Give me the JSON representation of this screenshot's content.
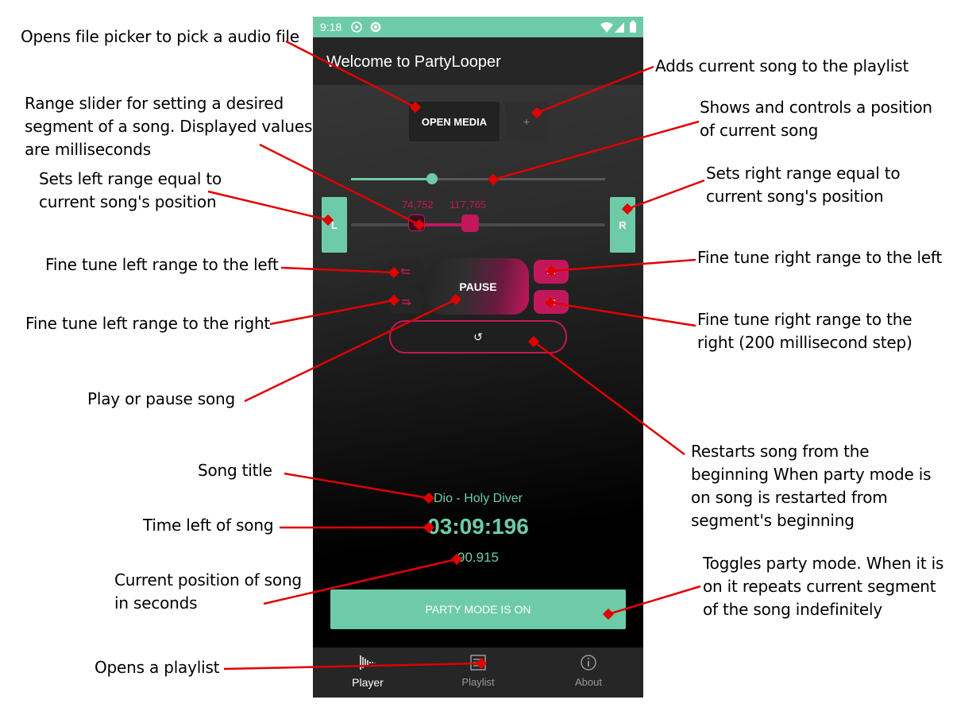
{
  "app": {
    "status_time": "9:18",
    "title": "Welcome to PartyLooper",
    "open_media_label": "OPEN MEDIA",
    "add_label": "+",
    "seek_progress": 0.32,
    "range": {
      "left_label": "74,752",
      "right_label": "117,765",
      "left_fraction": 0.26,
      "right_fraction": 0.47
    },
    "left_button_label": "L",
    "right_button_label": "R",
    "pause_label": "PAUSE",
    "restart_icon": "↺",
    "song_title": "Dio - Holy Diver",
    "time_left": "03:09:196",
    "position": "90.915",
    "party_label": "PARTY MODE IS ON",
    "nav": [
      {
        "label": "Player",
        "icon": "waveform-icon"
      },
      {
        "label": "Playlist",
        "icon": "playlist-icon"
      },
      {
        "label": "About",
        "icon": "info-icon"
      }
    ]
  },
  "annotations": {
    "open_media": "Opens file picker to pick a audio file",
    "add_song": "Adds current song to the playlist",
    "range_slider": "Range slider for setting a desired segment of a song. Displayed values are milliseconds",
    "seek": "Shows and controls a position of current song",
    "left_range": "Sets left range equal to current song's position",
    "right_range": "Sets right range equal to current song's position",
    "fine_left_left": "Fine tune left range to the left",
    "fine_right_left": "Fine tune right range to the left",
    "fine_left_right": "Fine tune left range to the right",
    "fine_right_right": "Fine tune right range to the right (200 millisecond step)",
    "play_pause": "Play or pause song",
    "restart": "Restarts song from the beginning When party mode is on song is restarted from segment's beginning",
    "song_title": "Song title",
    "time_left": "Time left of song",
    "current_position": "Current position of song in seconds",
    "party_mode": "Toggles party mode. When it is on it repeats current segment of the song indefinitely",
    "playlist": "Opens a playlist"
  },
  "colors": {
    "accent_green": "#6ecba8",
    "accent_pink": "#c2185b",
    "arrow_red": "#e00000"
  }
}
